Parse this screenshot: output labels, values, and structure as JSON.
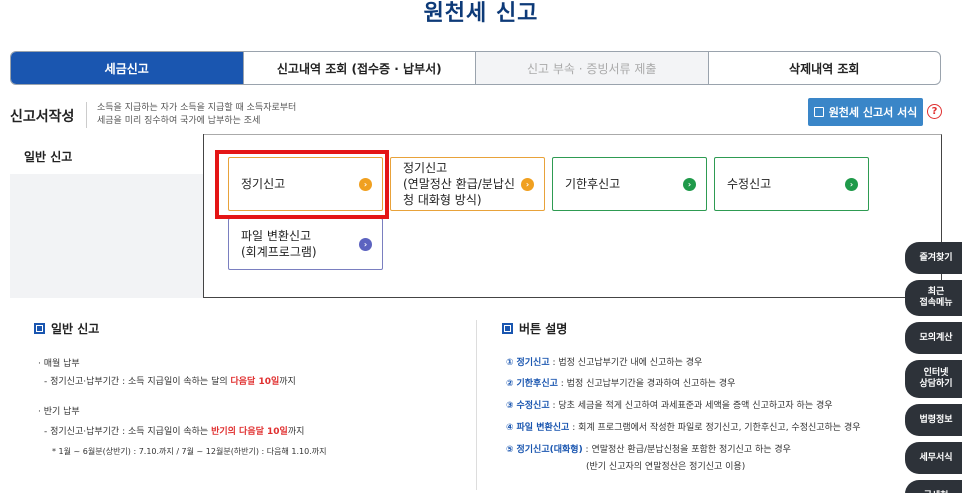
{
  "page_title": "원천세 신고",
  "tabs": [
    {
      "label": "세금신고",
      "state": "active"
    },
    {
      "label": "신고내역 조회 (접수증 · 납부서)",
      "state": "normal"
    },
    {
      "label": "신고 부속 · 증빙서류 제출",
      "state": "disabled"
    },
    {
      "label": "삭제내역 조회",
      "state": "normal"
    }
  ],
  "section": {
    "label": "신고서작성",
    "desc_line1": "소득을 지급하는 자가 소득을 지급할 때 소득자로부터",
    "desc_line2": "세금을 미리 징수하여 국가에 납부하는 조세",
    "form_button": "원천세 신고서 서식",
    "help_icon": "?"
  },
  "panel": {
    "side_tab": "일반 신고",
    "options": {
      "regular": "정기신고",
      "yearend_l1": "정기신고",
      "yearend_l2": "(연말정산 환급/분납신",
      "yearend_l3": "청 대화형 방식)",
      "late": "기한후신고",
      "amend": "수정신고",
      "file_l1": "파일 변환신고",
      "file_l2": "(회계프로그램)"
    },
    "arrow_glyph": "›"
  },
  "left_info": {
    "heading": "일반 신고",
    "monthly": "· 매월 납부",
    "monthly_detail_pre": "- 정기신고·납부기간 : 소득 지급일이 속하는 달의 ",
    "monthly_detail_red": "다음달 10일",
    "monthly_detail_post": "까지",
    "half": "· 반기 납부",
    "half_detail_pre": "- 정기신고·납부기간 : 소득 지급일이 속하는 ",
    "half_detail_red": "반기의 다음달 10일",
    "half_detail_post": "까지",
    "half_note": "* 1월 ~ 6월분(상반기) : 7.10.까지 / 7월 ~ 12월분(하반기) : 다음해 1.10.까지"
  },
  "right_info": {
    "heading": "버튼 설명",
    "items": [
      {
        "num": "①",
        "name": "정기신고",
        "desc": " : 법정 신고납부기간 내에 신고하는 경우"
      },
      {
        "num": "②",
        "name": "기한후신고",
        "desc": " : 법정 신고납부기간을 경과하여 신고하는 경우"
      },
      {
        "num": "③",
        "name": "수정신고",
        "desc": " : 당초 세금을 적게 신고하여 과세표준과 세액을 증액 신고하고자 하는 경우"
      },
      {
        "num": "④",
        "name": "파일 변환신고",
        "desc": " : 회계 프로그램에서 작성한 파일로 정기신고, 기한후신고, 수정신고하는 경우"
      },
      {
        "num": "⑤",
        "name": "정기신고(대화형)",
        "desc": " : 연말정산 환급/분납신청을 포함한 정기신고 하는 경우"
      }
    ],
    "note": "(반기 신고자의 연말정산은 정기신고 이용)"
  },
  "float_menu": [
    "즐겨찾기",
    "최근\n접속메뉴",
    "모의계산",
    "인터넷\n상담하기",
    "법령정보",
    "세무서식",
    "국세청"
  ]
}
